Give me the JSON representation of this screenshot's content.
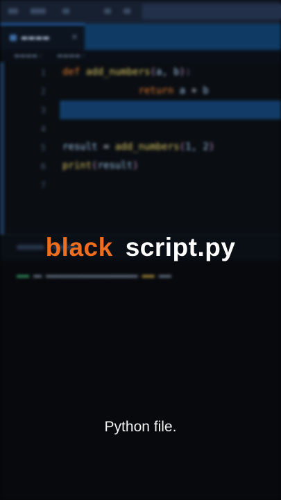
{
  "overlay": {
    "word1": "black",
    "word2": "script.py",
    "caption": "Python file."
  },
  "editor": {
    "line_numbers": [
      "1",
      "2",
      "3",
      "4",
      "5",
      "6",
      "7"
    ],
    "code": [
      [
        {
          "t": "def ",
          "c": "kw"
        },
        {
          "t": "add_numbers",
          "c": "fn"
        },
        {
          "t": "(",
          "c": "par"
        },
        {
          "t": "a, b",
          "c": "id"
        },
        {
          "t": "):",
          "c": "par"
        }
      ],
      [
        {
          "t": "             return ",
          "c": "kw"
        },
        {
          "t": "a",
          "c": "id"
        },
        {
          "t": " + ",
          "c": "op"
        },
        {
          "t": "b",
          "c": "id"
        }
      ],
      [],
      [],
      [
        {
          "t": "result ",
          "c": "id"
        },
        {
          "t": "= ",
          "c": "op"
        },
        {
          "t": "add_numbers",
          "c": "fn"
        },
        {
          "t": "(",
          "c": "par"
        },
        {
          "t": "1, 2",
          "c": "id"
        },
        {
          "t": ")",
          "c": "par"
        }
      ],
      [
        {
          "t": "print",
          "c": "fn"
        },
        {
          "t": "(",
          "c": "par"
        },
        {
          "t": "result",
          "c": "id"
        },
        {
          "t": ")",
          "c": "par"
        }
      ],
      []
    ]
  },
  "colors": {
    "accent_orange": "#ee6e1f",
    "tab_bar_blue": "#0f3a63",
    "current_line": "#123c67",
    "background": "#050608"
  },
  "icons": [
    "file-icon",
    "close-icon",
    "menu-icon"
  ]
}
